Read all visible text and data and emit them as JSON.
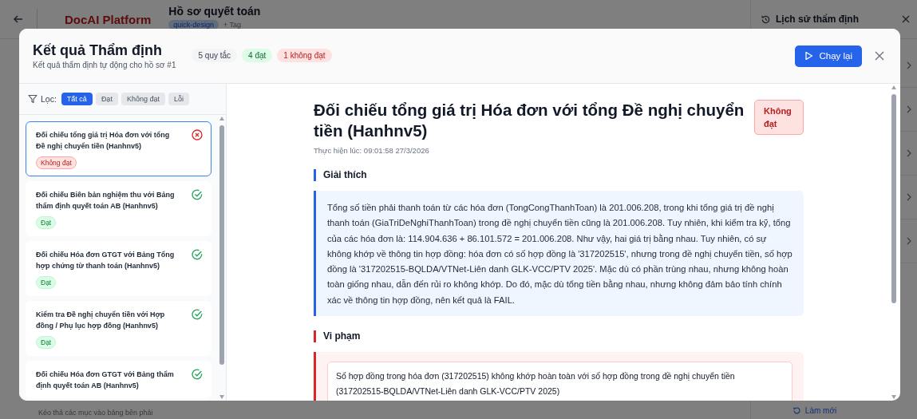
{
  "app": {
    "brand": "DocAI Platform",
    "title": "Hồ sơ quyết toán",
    "tag": "quick-design",
    "add_tag": "+ Tag",
    "drag_hint": "Kéo thả các mục vào bảng bên phải"
  },
  "history_panel": {
    "title": "Lịch sử thẩm định",
    "refresh": "Làm mới"
  },
  "modal": {
    "title": "Kết quả Thẩm định",
    "subtitle": "Kết quả thẩm định tự động cho hồ sơ #1",
    "summary": [
      {
        "label": "5 quy tắc",
        "kind": "total"
      },
      {
        "label": "4 đạt",
        "kind": "pass"
      },
      {
        "label": "1 không đạt",
        "kind": "fail"
      }
    ],
    "rerun_button": "Chạy lại",
    "filter": {
      "label": "Lọc:",
      "options": [
        {
          "label": "Tất cả",
          "selected": true
        },
        {
          "label": "Đạt",
          "selected": false
        },
        {
          "label": "Không đạt",
          "selected": false
        },
        {
          "label": "Lỗi",
          "selected": false
        }
      ]
    },
    "rules": [
      {
        "title": "Đối chiếu tổng giá trị Hóa đơn với tổng Đề nghị chuyển tiền (Hanhnv5)",
        "passed": false,
        "badge": "Không đạt",
        "selected": true
      },
      {
        "title": "Đối chiếu Biên bản nghiệm thu với Bảng thẩm định quyết toán AB (Hanhnv5)",
        "passed": true,
        "badge": "Đạt",
        "selected": false
      },
      {
        "title": "Đối chiếu Hóa đơn GTGT với Bảng Tổng hợp chứng từ thanh toán (Hanhnv5)",
        "passed": true,
        "badge": "Đạt",
        "selected": false
      },
      {
        "title": "Kiểm tra Đề nghị chuyển tiền với Hợp đồng / Phụ lục hợp đồng (Hanhnv5)",
        "passed": true,
        "badge": "Đạt",
        "selected": false
      },
      {
        "title": "Đối chiếu Hóa đơn GTGT với Bảng thẩm định quyết toán AB (Hanhnv5)",
        "passed": true,
        "selected": false
      }
    ],
    "detail": {
      "title": "Đối chiếu tổng giá trị Hóa đơn với tổng Đề nghị chuyển tiền (Hanhnv5)",
      "passed": false,
      "badge": "Không đạt",
      "executed_at": "Thực hiện lúc: 09:01:58 27/3/2026",
      "explanation_heading": "Giải thích",
      "explanation": "Tổng số tiền phải thanh toán từ các hóa đơn (TongCongThanhToan) là 201.006.208, trong khi tổng giá trị đề nghị thanh toán (GiaTriDeNghiThanhToan) trong đề nghị chuyển tiền cũng là 201.006.208. Tuy nhiên, khi kiểm tra kỹ, tổng của các hóa đơn là: 114.904.636 + 86.101.572 = 201.006.208. Như vậy, hai giá trị bằng nhau. Tuy nhiên, có sự không khớp về thông tin hợp đồng: hóa đơn có số hợp đồng là '317202515', nhưng trong đề nghị chuyển tiền, số hợp đồng là '317202515-BQLDA/VTNet-Liên danh GLK-VCC/PTV 2025'. Mặc dù có phần trùng nhau, nhưng không hoàn toàn giống nhau, dẫn đến rủi ro không khớp. Do đó, mặc dù tổng tiền bằng nhau, nhưng không đảm bảo tính chính xác về thông tin hợp đồng, nên kết quả là FAIL.",
      "violations_heading": "Vi phạm",
      "violations": [
        "Số hợp đồng trong hóa đơn (317202515) không khớp hoàn toàn với số hợp đồng trong đề nghị chuyển tiền (317202515-BQLDA/VTNet-Liên danh GLK-VCC/PTV 2025)"
      ]
    }
  }
}
